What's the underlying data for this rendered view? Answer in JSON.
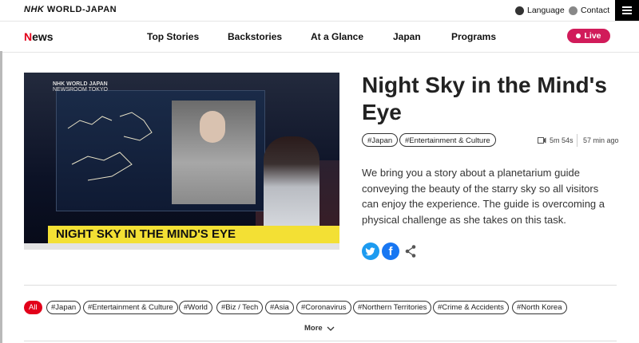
{
  "header": {
    "logo_nhk": "NHK",
    "logo_world": "WORLD-JAPAN",
    "language": "Language",
    "contact": "Contact"
  },
  "nav": {
    "news_label": "News",
    "items": [
      "Top Stories",
      "Backstories",
      "At a Glance",
      "Japan",
      "Programs"
    ],
    "live": "Live"
  },
  "video": {
    "watermark": "NHK WORLD JAPAN",
    "watermark_sub": "NEWSROOM TOKYO",
    "caption": "NIGHT SKY IN THE MIND'S EYE"
  },
  "article": {
    "title": "Night Sky in the Mind's Eye",
    "tags": [
      "#Japan",
      "#Entertainment & Culture"
    ],
    "duration": "5m 54s",
    "time_ago": "57 min ago",
    "summary": "We bring you a story about a planetarium guide conveying the beauty of the starry sky so all visitors can enjoy the experience. The guide is overcoming a physical challenge as she takes on this task."
  },
  "filters": {
    "chips": [
      "All",
      "#Japan",
      "#Entertainment & Culture",
      "#World",
      "#Biz / Tech",
      "#Asia",
      "#Coronavirus",
      "#Northern Territories",
      "#Crime & Accidents",
      "#North Korea"
    ],
    "more": "More"
  },
  "colors": {
    "brand_red": "#e2001a",
    "live_pink": "#d11b5a",
    "twitter": "#1d9bf0",
    "facebook": "#1877f2",
    "caption_yellow": "#f3e034"
  }
}
